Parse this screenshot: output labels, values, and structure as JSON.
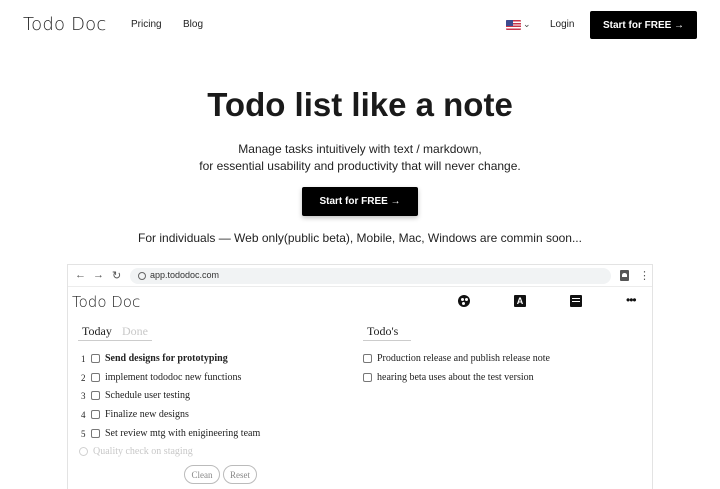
{
  "nav": {
    "logo": "Todo Doc",
    "links": [
      "Pricing",
      "Blog"
    ],
    "locale_icon": "us-flag-icon",
    "login": "Login",
    "cta": "Start for FREE →"
  },
  "hero": {
    "title": "Todo list like a note",
    "subtitle_line1": "Manage tasks intuitively with text / markdown,",
    "subtitle_line2": "for essential usability and productivity that will never change.",
    "cta": "Start for FREE  →",
    "availability": "For individuals — Web only(public beta), Mobile, Mac, Windows are commin soon..."
  },
  "browser": {
    "url": "app.tododoc.com",
    "icons": [
      "back-arrow-icon",
      "forward-arrow-icon",
      "reload-icon",
      "globe-icon",
      "profile-icon",
      "kebab-menu-icon"
    ]
  },
  "app": {
    "logo": "Todo Doc",
    "toolbar_icons": [
      "palette-icon",
      "font-icon",
      "comment-icon",
      "more-icon"
    ],
    "font_icon_glyph": "A",
    "more_icon_glyph": "•••",
    "tabs": {
      "today": "Today",
      "done": "Done"
    },
    "today_tasks": [
      {
        "num": "1",
        "label": "Send designs for prototyping",
        "bold": true
      },
      {
        "num": "2",
        "label": "implement tododoc new functions"
      },
      {
        "num": "3",
        "label": "Schedule user testing"
      },
      {
        "num": "4",
        "label": "Finalize new designs"
      },
      {
        "num": "5",
        "label": "Set review mtg with enigineering team"
      },
      {
        "num": "",
        "label": "Quality check on staging",
        "placeholder": true
      }
    ],
    "todos_title": "Todo's",
    "todos": [
      {
        "label": "Production release and publish release note"
      },
      {
        "label": "hearing beta uses about the test version"
      }
    ],
    "buttons": {
      "clean": "Clean",
      "reset": "Reset"
    }
  },
  "colors": {
    "cta_bg": "#000000",
    "cta_text": "#ffffff",
    "muted": "#c8c8c8"
  }
}
